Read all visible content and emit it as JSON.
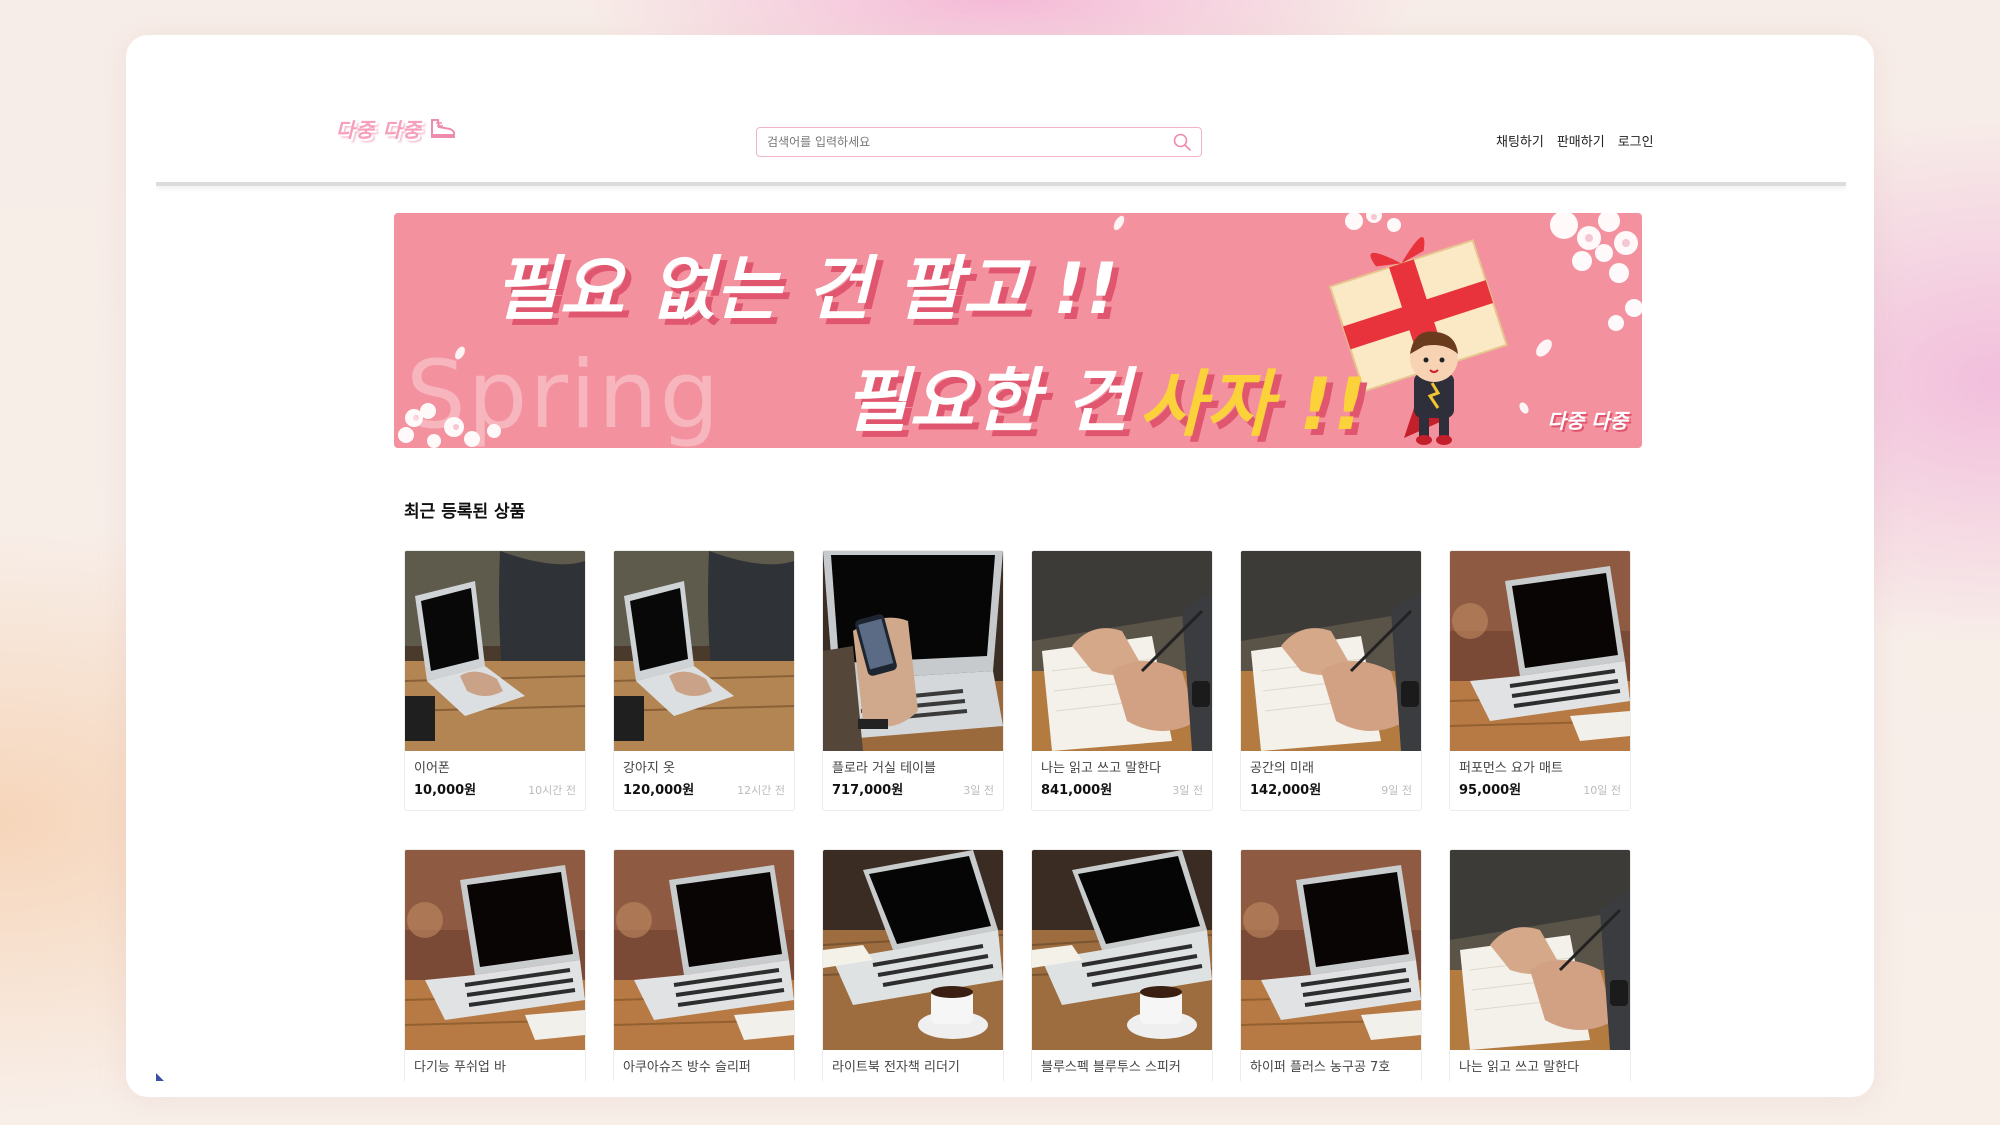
{
  "header": {
    "logo_text": "다중 다중",
    "search_placeholder": "검색어를 입력하세요",
    "nav": [
      "채팅하기",
      "판매하기",
      "로그인"
    ]
  },
  "banner": {
    "line1": "필요 없는 건 팔고 !!",
    "line2": "필요한 건",
    "accent": "사자 !!",
    "watermark": "Spring",
    "brand": "다중 다중"
  },
  "section": {
    "title": "최근 등록된 상품"
  },
  "products": [
    {
      "name": "이어폰",
      "price": "10,000원",
      "time": "10시간 전",
      "image": "laptop-typing"
    },
    {
      "name": "강아지 옷",
      "price": "120,000원",
      "time": "12시간 전",
      "image": "laptop-typing"
    },
    {
      "name": "플로라 거실 테이블",
      "price": "717,000원",
      "time": "3일 전",
      "image": "phone-laptop"
    },
    {
      "name": "나는 읽고 쓰고 말한다",
      "price": "841,000원",
      "time": "3일 전",
      "image": "notebook-writing"
    },
    {
      "name": "공간의 미래",
      "price": "142,000원",
      "time": "9일 전",
      "image": "notebook-writing"
    },
    {
      "name": "퍼포먼스 요가 매트",
      "price": "95,000원",
      "time": "10일 전",
      "image": "laptop-table"
    },
    {
      "name": "다기능 푸쉬업 바",
      "price": "",
      "time": "",
      "image": "laptop-table"
    },
    {
      "name": "아쿠아슈즈 방수 슬리퍼",
      "price": "",
      "time": "",
      "image": "laptop-table"
    },
    {
      "name": "라이트북 전자책 리더기",
      "price": "",
      "time": "",
      "image": "laptop-coffee"
    },
    {
      "name": "블루스펙 블루투스 스피커",
      "price": "",
      "time": "",
      "image": "laptop-coffee"
    },
    {
      "name": "하이퍼 플러스 농구공 7호",
      "price": "",
      "time": "",
      "image": "laptop-table"
    },
    {
      "name": "나는 읽고 쓰고 말한다",
      "price": "",
      "time": "",
      "image": "notebook-writing"
    }
  ],
  "colors": {
    "accent": "#f3919f",
    "brand_pink": "#f6a0bb",
    "banner_yellow": "#fcd23b"
  }
}
